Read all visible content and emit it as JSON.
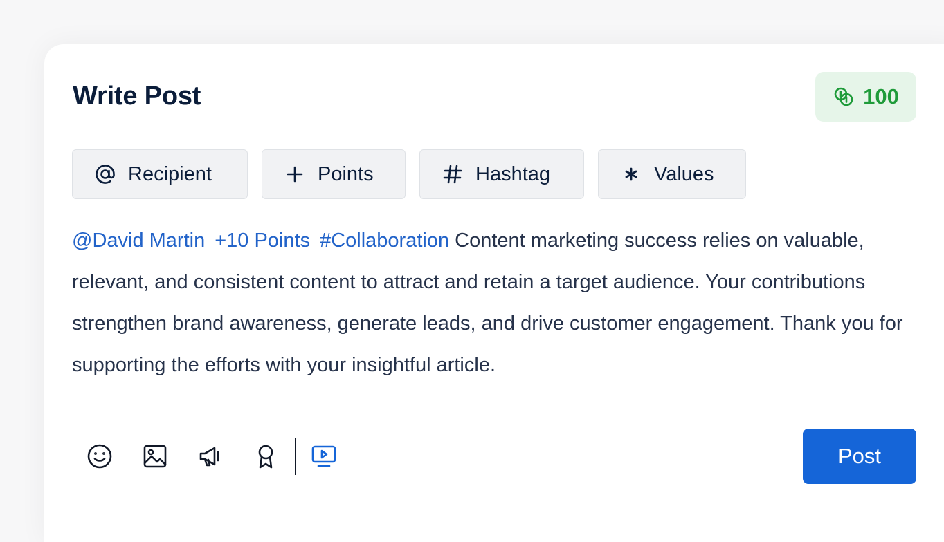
{
  "header": {
    "title": "Write Post",
    "points_balance": "100"
  },
  "chips": [
    {
      "label": "Recipient",
      "icon": "at-icon"
    },
    {
      "label": "Points",
      "icon": "plus-icon"
    },
    {
      "label": "Hashtag",
      "icon": "hashtag-icon"
    },
    {
      "label": "Values",
      "icon": "asterisk-icon"
    }
  ],
  "message": {
    "recipient_tag": "@David Martin",
    "points_tag": "+10 Points",
    "hashtag_tag": "#Collaboration",
    "body": " Content marketing success relies on valuable, relevant, and consistent content to attract and retain a target audience. Your contributions strengthen brand awareness, generate leads, and drive customer engagement. Thank you for supporting the efforts with your insightful article."
  },
  "toolbar": {
    "icons": [
      "emoji-icon",
      "image-icon",
      "megaphone-icon",
      "award-icon",
      "video-icon"
    ]
  },
  "actions": {
    "post_label": "Post"
  },
  "colors": {
    "title": "#0b1d3a",
    "badge_bg": "#e6f5e9",
    "badge_text": "#1f9b3a",
    "tag": "#2263c9",
    "primary": "#1565d8",
    "chip_bg": "#f1f2f4"
  }
}
